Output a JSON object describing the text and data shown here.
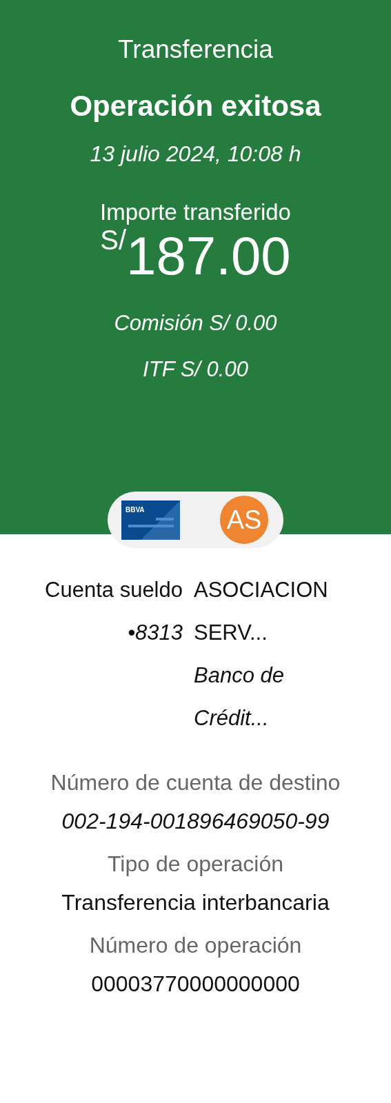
{
  "header": {
    "title": "Transferencia",
    "status": "Operación exitosa",
    "datetime": "13 julio 2024, 10:08 h",
    "amount_label": "Importe transferido",
    "currency": "S/",
    "amount": "187.00",
    "commission": "Comisión S/ 0.00",
    "itf": "ITF S/ 0.00"
  },
  "parties": {
    "origin_logo": "BBVA",
    "destination_initials": "AS"
  },
  "origin": {
    "name": "Cuenta sueldo",
    "number": "•8313"
  },
  "destination": {
    "name": "ASOCIACION SERV...",
    "bank": "Banco de Crédit..."
  },
  "details": [
    {
      "label": "Número de cuenta de destino",
      "value": "002-194-001896469050-99",
      "italic": true
    },
    {
      "label": "Tipo de operación",
      "value": "Transferencia interbancaria",
      "italic": false
    },
    {
      "label": "Número de operación",
      "value": "00003770000000000",
      "italic": false
    }
  ]
}
